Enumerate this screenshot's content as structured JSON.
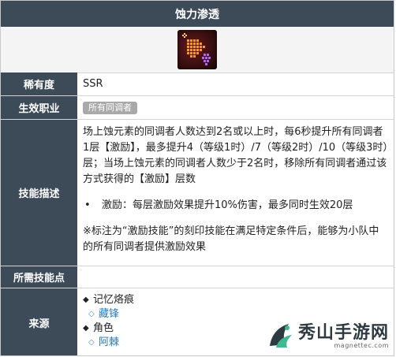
{
  "header": {
    "title": "蚀力渗透"
  },
  "skill_icon": {
    "icon": "skill-emblem-icon"
  },
  "rows": {
    "rarity": {
      "label": "稀有度",
      "value": "SSR"
    },
    "job": {
      "label": "生效职业",
      "tag": "所有同调者"
    },
    "description": {
      "label": "技能描述",
      "paragraph": "场上蚀元素的同调者人数达到2名或以上时，每6秒提升所有同调者1层【激励】，最多提升4（等级1时）/7（等级2时）/10（等级3时）层；当场上蚀元素的同调者人数少于2名时，移除所有同调者通过该方式获得的【激励】层数",
      "bullet": "激励：每层激励效果提升10%伤害，最多同时生效20层",
      "note": "※标注为“激励技能”的刻印技能在满足特定条件后，能够为小队中的所有同调者提供激励效果"
    },
    "required": {
      "label": "所需技能点",
      "value": ""
    },
    "source": {
      "label": "来源",
      "groups": [
        {
          "title": "记忆烙痕",
          "item": "藏锋"
        },
        {
          "title": "角色",
          "item": "阿棘"
        }
      ]
    }
  },
  "watermark": {
    "text": "秀山手游网",
    "url": "magnettec.com"
  },
  "colors": {
    "header_bg": "#3d4a57",
    "link": "#2a78b8",
    "tag_bg": "#a9a9a9"
  }
}
